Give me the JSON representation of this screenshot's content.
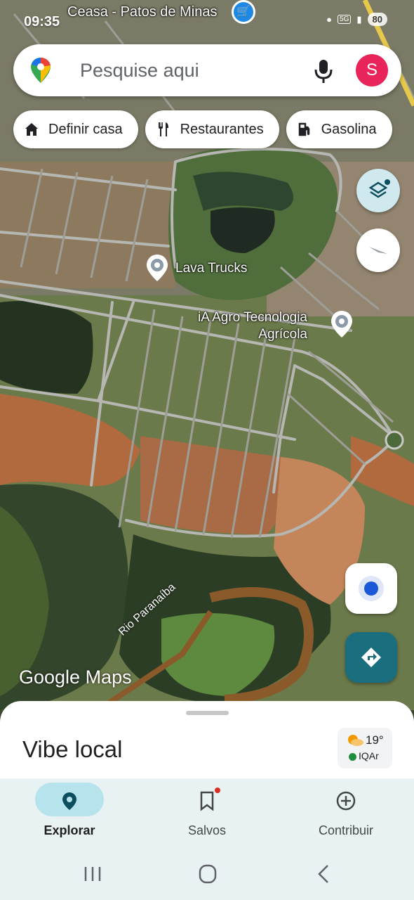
{
  "status_bar": {
    "time": "09:35",
    "network": "5G",
    "battery": "80"
  },
  "map": {
    "top_place_label": "Ceasa - Patos de Minas",
    "places": [
      {
        "name": "Lava Trucks"
      },
      {
        "name": "iA Agro Tecnologia\nAgrícola"
      }
    ],
    "river_label": "Rio Paranaíba",
    "watermark": "Google Maps"
  },
  "search": {
    "placeholder": "Pesquise aqui",
    "avatar_letter": "S"
  },
  "chips": [
    {
      "label": "Definir casa",
      "icon": "home-icon"
    },
    {
      "label": "Restaurantes",
      "icon": "restaurant-icon"
    },
    {
      "label": "Gasolina",
      "icon": "gas-station-icon"
    }
  ],
  "sheet": {
    "title": "Vibe local",
    "weather": {
      "temp": "19°",
      "air_quality": "IQAr",
      "icon": "partly-sunny-icon"
    }
  },
  "bottom_nav": [
    {
      "label": "Explorar",
      "icon": "explore-pin-icon",
      "active": true
    },
    {
      "label": "Salvos",
      "icon": "bookmark-icon",
      "active": false
    },
    {
      "label": "Contribuir",
      "icon": "add-circle-icon",
      "active": false
    }
  ],
  "colors": {
    "accent": "#1a6e7e",
    "active_pill": "#b7e3ec",
    "avatar": "#e8245a",
    "location_dot": "#1a58d8"
  }
}
